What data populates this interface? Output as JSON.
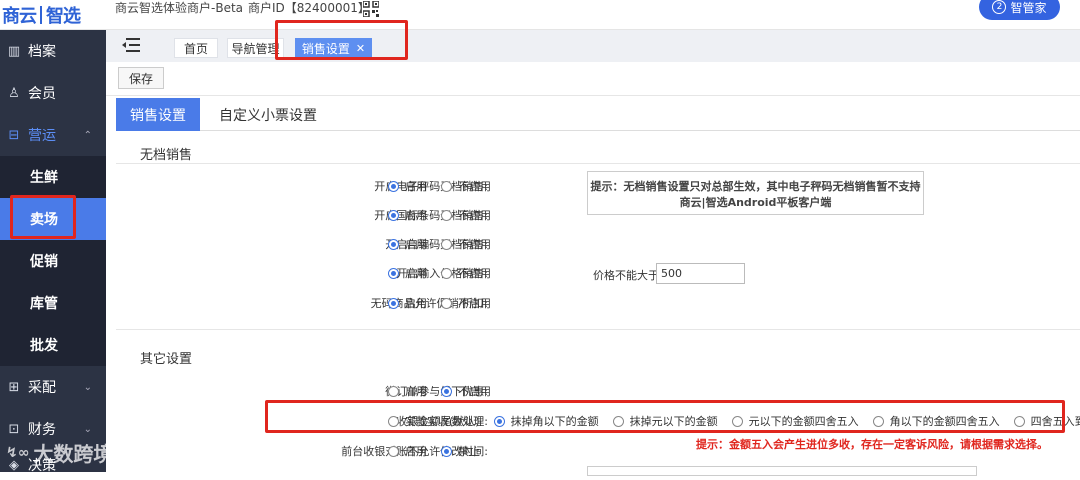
{
  "header": {
    "logo_part1": "商云",
    "logo_part2": "智选",
    "merchant_name": "商云智选体验商户-Beta",
    "merchant_id": "商户ID【82400001】",
    "assistant_button": "智管家"
  },
  "sidebar": {
    "items": [
      {
        "label": "档案",
        "icon": "archive-icon"
      },
      {
        "label": "会员",
        "icon": "user-icon"
      },
      {
        "label": "营运",
        "icon": "briefcase-icon",
        "chevron": "⌃"
      },
      {
        "label": "采配",
        "icon": "cart-icon",
        "chevron": "⌄"
      },
      {
        "label": "财务",
        "icon": "finance-icon",
        "chevron": "⌄"
      },
      {
        "label": "决策",
        "icon": "decision-icon"
      }
    ],
    "subitems": [
      "生鲜",
      "卖场",
      "促销",
      "库管",
      "批发"
    ],
    "selected_subitem": "卖场"
  },
  "tabs": [
    {
      "label": "首页"
    },
    {
      "label": "导航管理"
    },
    {
      "label": "销售设置",
      "close": "✕"
    }
  ],
  "toolbar": {
    "save_label": "保存"
  },
  "content_tabs": [
    "销售设置",
    "自定义小票设置"
  ],
  "sections": {
    "no_barcode": "无档销售",
    "other": "其它设置"
  },
  "no_barcode_rows": [
    {
      "label": "开启电子秤码无档销售:",
      "options": [
        "启用",
        "不启用"
      ],
      "selected": 0
    },
    {
      "label": "开启国标条码无档销售:",
      "options": [
        "启用",
        "不启用"
      ],
      "selected": 0
    },
    {
      "label": "开启自编码无档销售:",
      "options": [
        "启用",
        "不启用"
      ],
      "selected": 0
    },
    {
      "label": "开启输入价格销售:",
      "options": [
        "启用",
        "不启用"
      ],
      "selected": 0
    },
    {
      "label": "无码商品允许促销/折扣:",
      "options": [
        "启用",
        "不启用"
      ],
      "selected": 0
    }
  ],
  "hint": {
    "line1": "提示：无档销售设置只对总部生效，其中电子秤码无档销售暂不支持",
    "line2": "商云|智选Android平板客户端"
  },
  "price_limit": {
    "label": "价格不能大于:",
    "value": "500"
  },
  "other_rows": [
    {
      "label": "微订单参与线下优惠:",
      "options": [
        "启用",
        "不启用"
      ],
      "selected": 1
    },
    {
      "label": "收银金额尾数处理:",
      "options": [
        "实款实收(默认)",
        "抹掉角以下的金额",
        "抹掉元以下的金额",
        "元以下的金额四舍五入",
        "角以下的金额四舍五入",
        "四舍五入到五角"
      ],
      "selected": 1
    },
    {
      "label": "前台收银对账不允许修改时间:",
      "options": [
        "启用",
        "禁止"
      ],
      "selected": 1
    }
  ],
  "warning": "提示：金额五入会产生进位多收，存在一定客诉风险，请根据需求选择。",
  "watermark": "大数跨境",
  "colors": {
    "accent": "#4a7be8",
    "sidebar": "#2c3344",
    "highlight": "#e0261e",
    "warning": "#e0261e"
  }
}
